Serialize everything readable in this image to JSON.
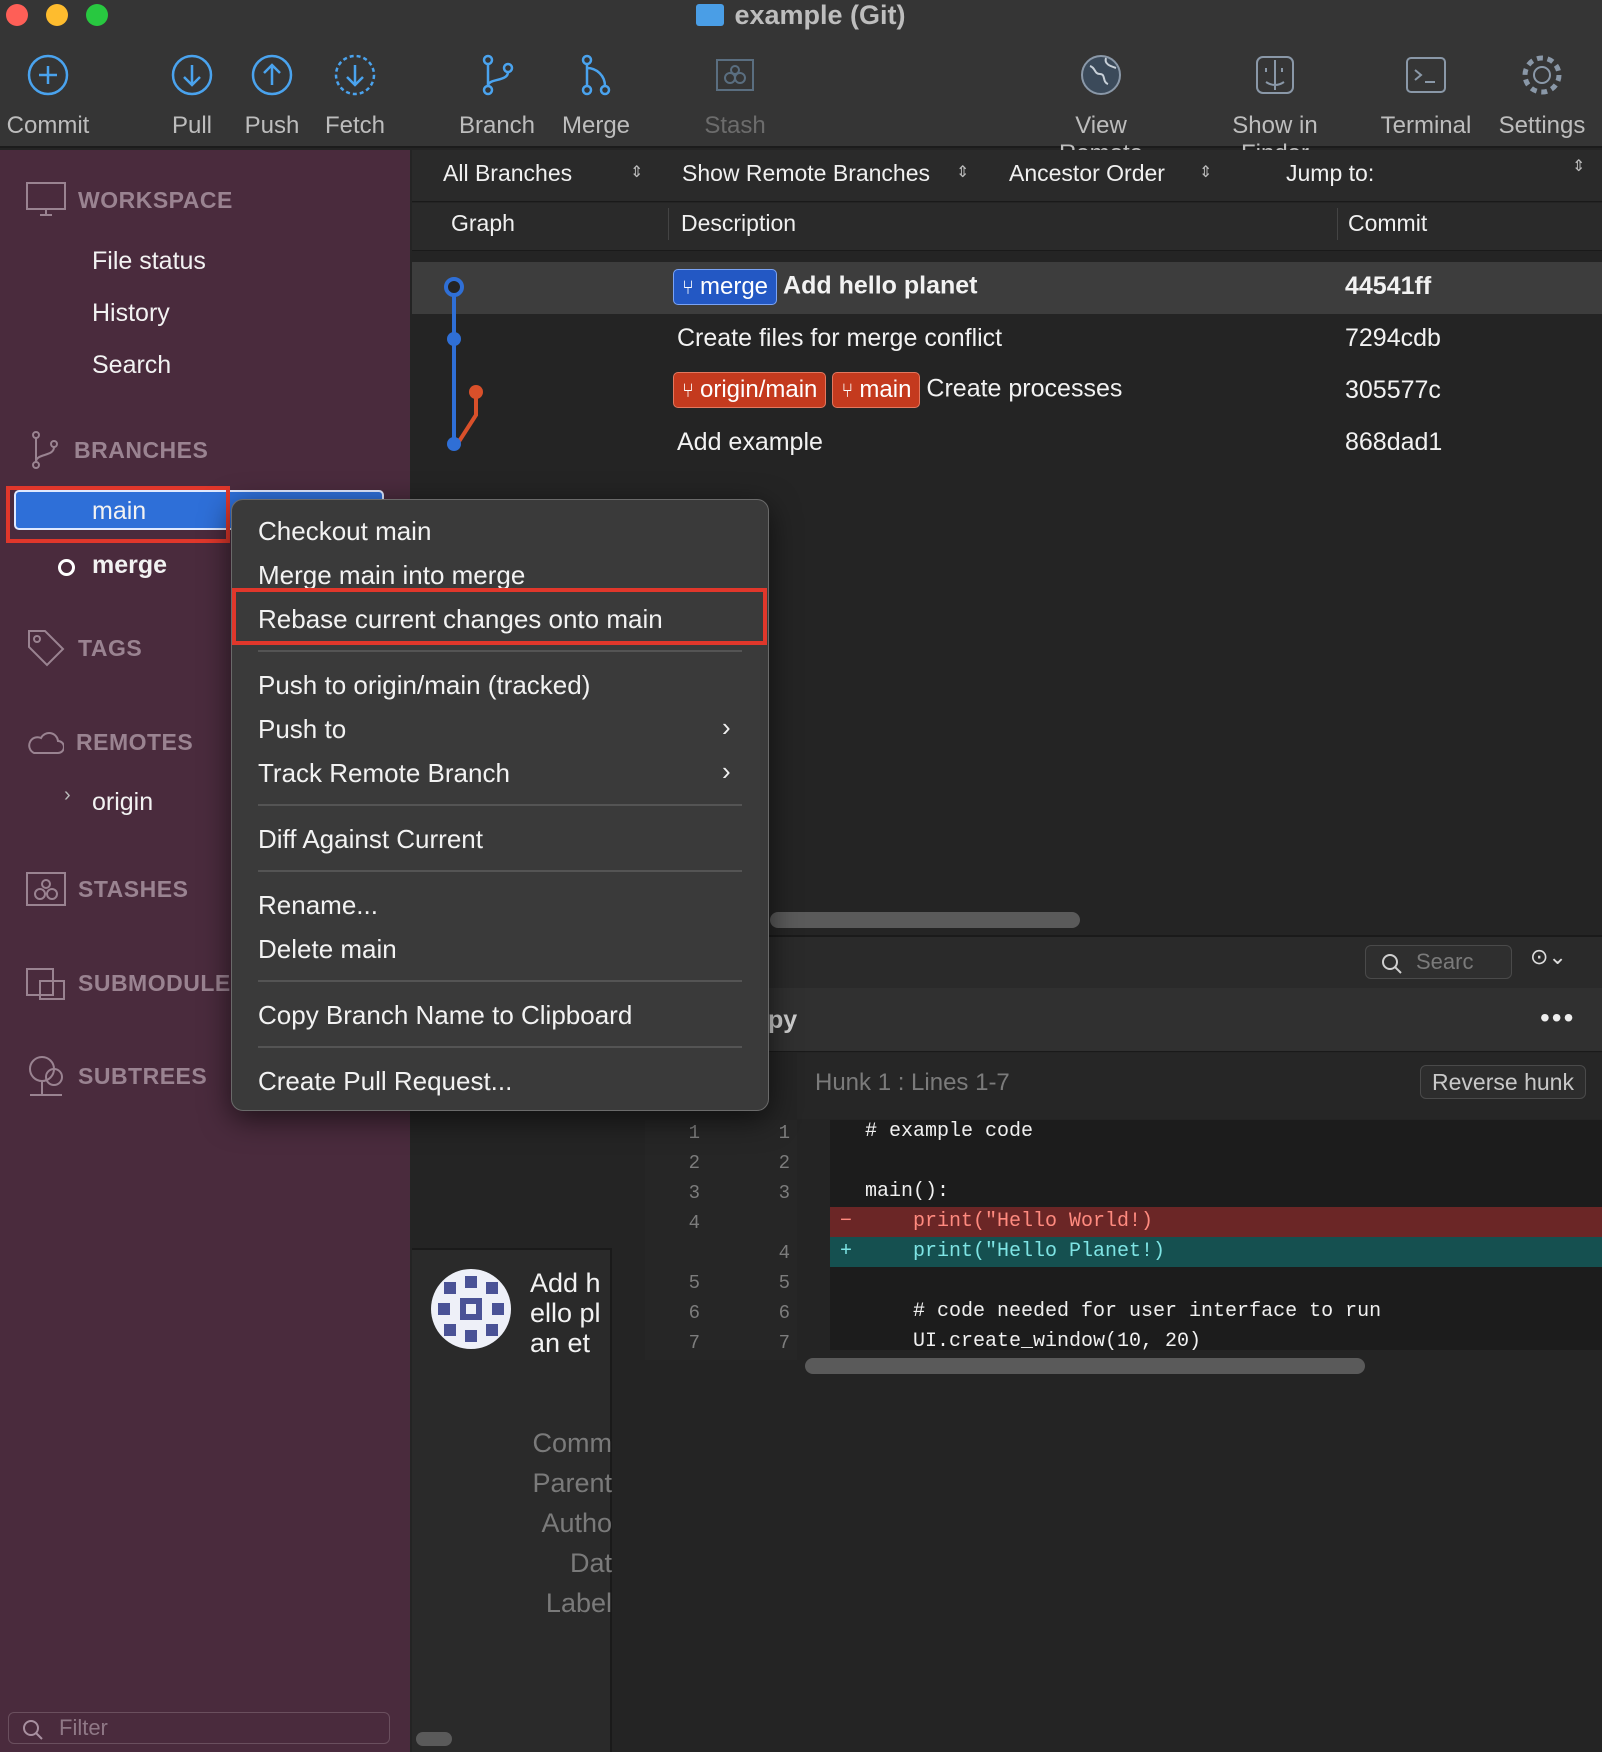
{
  "window": {
    "title": "example (Git)"
  },
  "toolbar": {
    "commit": "Commit",
    "pull": "Pull",
    "push": "Push",
    "fetch": "Fetch",
    "branch": "Branch",
    "merge": "Merge",
    "stash": "Stash",
    "view_remote": "View Remote",
    "show_in_finder": "Show in Finder",
    "terminal": "Terminal",
    "settings": "Settings"
  },
  "sidebar": {
    "workspace": "WORKSPACE",
    "workspace_items": [
      "File status",
      "History",
      "Search"
    ],
    "branches": "BRANCHES",
    "branch_items": [
      "main",
      "merge"
    ],
    "tags": "TAGS",
    "remotes": "REMOTES",
    "remote_items": [
      "origin"
    ],
    "stashes": "STASHES",
    "submodules": "SUBMODULES",
    "subtrees": "SUBTREES",
    "filter_placeholder": "Filter"
  },
  "history": {
    "branch_filter": "All Branches",
    "remote_filter": "Show Remote Branches",
    "order": "Ancestor Order",
    "jump": "Jump to:",
    "columns": [
      "Graph",
      "Description",
      "Commit"
    ],
    "rows": [
      {
        "tags": [
          "merge"
        ],
        "desc": "Add hello planet",
        "commit": "44541ff"
      },
      {
        "tags": [],
        "desc": "Create files for merge conflict",
        "commit": "7294cdb"
      },
      {
        "tags": [
          "origin/main",
          "main"
        ],
        "desc": "Create processes",
        "commit": "305577c"
      },
      {
        "tags": [],
        "desc": "Add example",
        "commit": "868dad1"
      }
    ]
  },
  "details": {
    "search_placeholder": "Searc",
    "file_name_fragment": "py",
    "hunk_title": "Hunk 1 : Lines 1-7",
    "reverse_hunk": "Reverse hunk",
    "commit_title_wrapped": "Add hello plan et",
    "labels": [
      "Comm",
      "Parent",
      "Autho",
      "Dat",
      "Label"
    ]
  },
  "diff": {
    "lines": [
      {
        "old": "1",
        "new": "1",
        "type": "ctx",
        "text": "# example code"
      },
      {
        "old": "2",
        "new": "2",
        "type": "ctx",
        "text": ""
      },
      {
        "old": "3",
        "new": "3",
        "type": "ctx",
        "text": "main():"
      },
      {
        "old": "4",
        "new": "",
        "type": "del",
        "text": "    print(\"Hello World!)"
      },
      {
        "old": "",
        "new": "4",
        "type": "add",
        "text": "    print(\"Hello Planet!)"
      },
      {
        "old": "5",
        "new": "5",
        "type": "ctx",
        "text": ""
      },
      {
        "old": "6",
        "new": "6",
        "type": "ctx",
        "text": "    # code needed for user interface to run"
      },
      {
        "old": "7",
        "new": "7",
        "type": "ctx",
        "text": "    UI.create_window(10, 20)"
      }
    ]
  },
  "context_menu": {
    "items": [
      "Checkout main",
      "Merge main into merge",
      "Rebase current changes onto main",
      "Push to origin/main (tracked)",
      "Push to",
      "Track Remote Branch",
      "Diff Against Current",
      "Rename...",
      "Delete main",
      "Copy Branch Name to Clipboard",
      "Create Pull Request..."
    ]
  },
  "colors": {
    "accent": "#2e6fd8",
    "sidebar": "#4a2b3d",
    "highlight_box": "#e0372b",
    "graph_blue": "#2f6fd6",
    "graph_orange": "#d9502a"
  }
}
